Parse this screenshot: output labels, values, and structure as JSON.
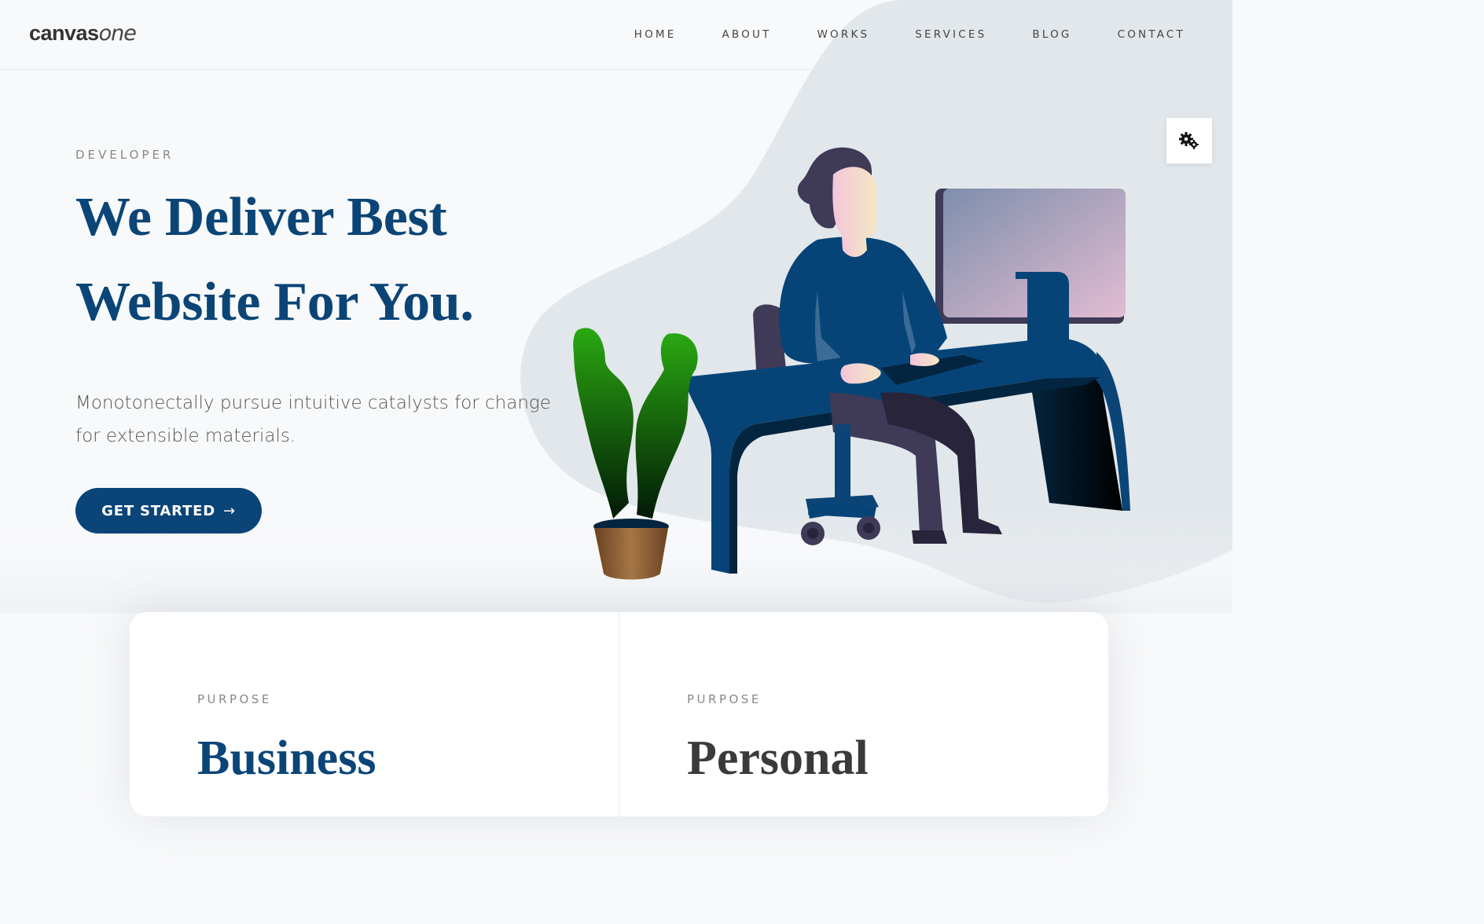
{
  "header": {
    "logo_bold": "canvas",
    "logo_light": "one",
    "nav": [
      "HOME",
      "ABOUT",
      "WORKS",
      "SERVICES",
      "BLOG",
      "CONTACT"
    ]
  },
  "hero": {
    "eyebrow": "DEVELOPER",
    "headline_line1": "We Deliver Best",
    "headline_line2": "Website For You.",
    "subtext": "Monotonectally pursue intuitive catalysts for change for extensible materials.",
    "cta_label": "GET STARTED",
    "cta_icon": "arrow-right-icon"
  },
  "settings": {
    "icon": "gears-icon"
  },
  "cards": [
    {
      "eyebrow": "PURPOSE",
      "title": "Business"
    },
    {
      "eyebrow": "PURPOSE",
      "title": "Personal"
    }
  ],
  "colors": {
    "brand_blue": "#0b4577",
    "background": "#f8f9fa",
    "blob": "#e2e7eb"
  }
}
